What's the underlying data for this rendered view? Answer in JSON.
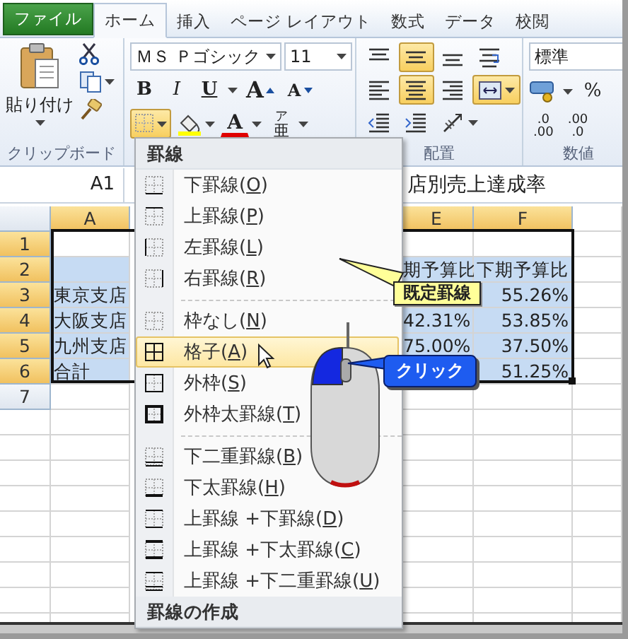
{
  "tabs": [
    {
      "label": "ファイル",
      "kind": "file",
      "selected": false
    },
    {
      "label": "ホーム",
      "kind": "tab",
      "selected": true
    },
    {
      "label": "挿入",
      "kind": "tab",
      "selected": false
    },
    {
      "label": "ページ レイアウト",
      "kind": "tab",
      "selected": false
    },
    {
      "label": "数式",
      "kind": "tab",
      "selected": false
    },
    {
      "label": "データ",
      "kind": "tab",
      "selected": false
    },
    {
      "label": "校閲",
      "kind": "tab",
      "selected": false
    }
  ],
  "clipboard": {
    "paste_label": "貼り付け",
    "group_label": "クリップボード"
  },
  "font": {
    "font_name": "ＭＳ Ｐゴシック",
    "font_size": "11",
    "bold": "B",
    "italic": "I",
    "underline": "U",
    "grow": "A",
    "shrink": "A",
    "font_color": "A",
    "phonetic": "亜",
    "phonetic_ruby": "ア",
    "borders_selected": true
  },
  "alignment": {
    "group_label": "配置",
    "buttons": [
      {
        "kind": "top",
        "selected": false
      },
      {
        "kind": "middle",
        "selected": true
      },
      {
        "kind": "bottom",
        "selected": false
      },
      {
        "kind": "wrap",
        "selected": false
      },
      {
        "kind": "left",
        "selected": false
      },
      {
        "kind": "center",
        "selected": true
      },
      {
        "kind": "right",
        "selected": false
      },
      {
        "kind": "merge",
        "selected": true
      },
      {
        "kind": "outdent",
        "selected": false
      },
      {
        "kind": "indent",
        "selected": false
      },
      {
        "kind": "orientation",
        "selected": false
      }
    ]
  },
  "number": {
    "format": "標準",
    "percent": "%",
    "increase_decimal": [
      ".0",
      ".00"
    ],
    "decrease_decimal": [
      ".00",
      ".0"
    ],
    "group_label": "数値"
  },
  "sheet": {
    "name_box": "A1",
    "formula": "店別売上達成率",
    "columns": [
      {
        "label": "A",
        "selected": true
      },
      {
        "label": "E",
        "selected": true
      },
      {
        "label": "F",
        "selected": true
      }
    ],
    "rows": [
      {
        "label": "1",
        "selected": true,
        "filled": false
      },
      {
        "label": "2",
        "selected": true,
        "filled": true,
        "e": "期予算比",
        "f": "下期予算比"
      },
      {
        "label": "3",
        "selected": true,
        "filled": true,
        "a": "東京支店",
        "f": "55.26%"
      },
      {
        "label": "4",
        "selected": true,
        "filled": true,
        "a": "大阪支店",
        "e": "42.31%",
        "f": "53.85%"
      },
      {
        "label": "5",
        "selected": true,
        "filled": true,
        "a": "九州支店",
        "e": "75.00%",
        "f": "37.50%"
      },
      {
        "label": "6",
        "selected": true,
        "filled": true,
        "a": "合計",
        "f": "51.25%"
      },
      {
        "label": "7",
        "selected": false,
        "filled": false
      }
    ]
  },
  "menu": [
    {
      "kind": "header",
      "label": "罫線"
    },
    {
      "kind": "bottom",
      "label": "下罫線(",
      "access_key": "O",
      "suffix": ")",
      "selected": false
    },
    {
      "kind": "top",
      "label": "上罫線(",
      "access_key": "P",
      "suffix": ")",
      "selected": false
    },
    {
      "kind": "left",
      "label": "左罫線(",
      "access_key": "L",
      "suffix": ")",
      "selected": false
    },
    {
      "kind": "right",
      "label": "右罫線(",
      "access_key": "R",
      "suffix": ")",
      "selected": false
    },
    {
      "kind": "separator"
    },
    {
      "kind": "none",
      "label": "枠なし(",
      "access_key": "N",
      "suffix": ")",
      "selected": false
    },
    {
      "kind": "all",
      "label": "格子(",
      "access_key": "A",
      "suffix": ")",
      "selected": true
    },
    {
      "kind": "outside",
      "label": "外枠(",
      "access_key": "S",
      "suffix": ")",
      "selected": false
    },
    {
      "kind": "thick_outside",
      "label": "外枠太罫線(",
      "access_key": "T",
      "suffix": ")",
      "selected": false
    },
    {
      "kind": "separator"
    },
    {
      "kind": "double_bottom",
      "label": "下二重罫線(",
      "access_key": "B",
      "suffix": ")",
      "selected": false
    },
    {
      "kind": "thick_bottom",
      "label": "下太罫線(",
      "access_key": "H",
      "suffix": ")",
      "selected": false
    },
    {
      "kind": "top_bottom",
      "label": "上罫線 +下罫線(",
      "access_key": "D",
      "suffix": ")",
      "selected": false
    },
    {
      "kind": "top_thick_bottom",
      "label": "上罫線 +下太罫線(",
      "access_key": "C",
      "suffix": ")",
      "selected": false
    },
    {
      "kind": "top_double_bottom",
      "label": "上罫線 +下二重罫線(",
      "access_key": "U",
      "suffix": ")",
      "selected": false
    },
    {
      "kind": "header",
      "label": "罫線の作成"
    }
  ],
  "callouts": [
    {
      "kind": "note",
      "text": "既定罫線"
    },
    {
      "kind": "click",
      "text": "クリック"
    }
  ]
}
